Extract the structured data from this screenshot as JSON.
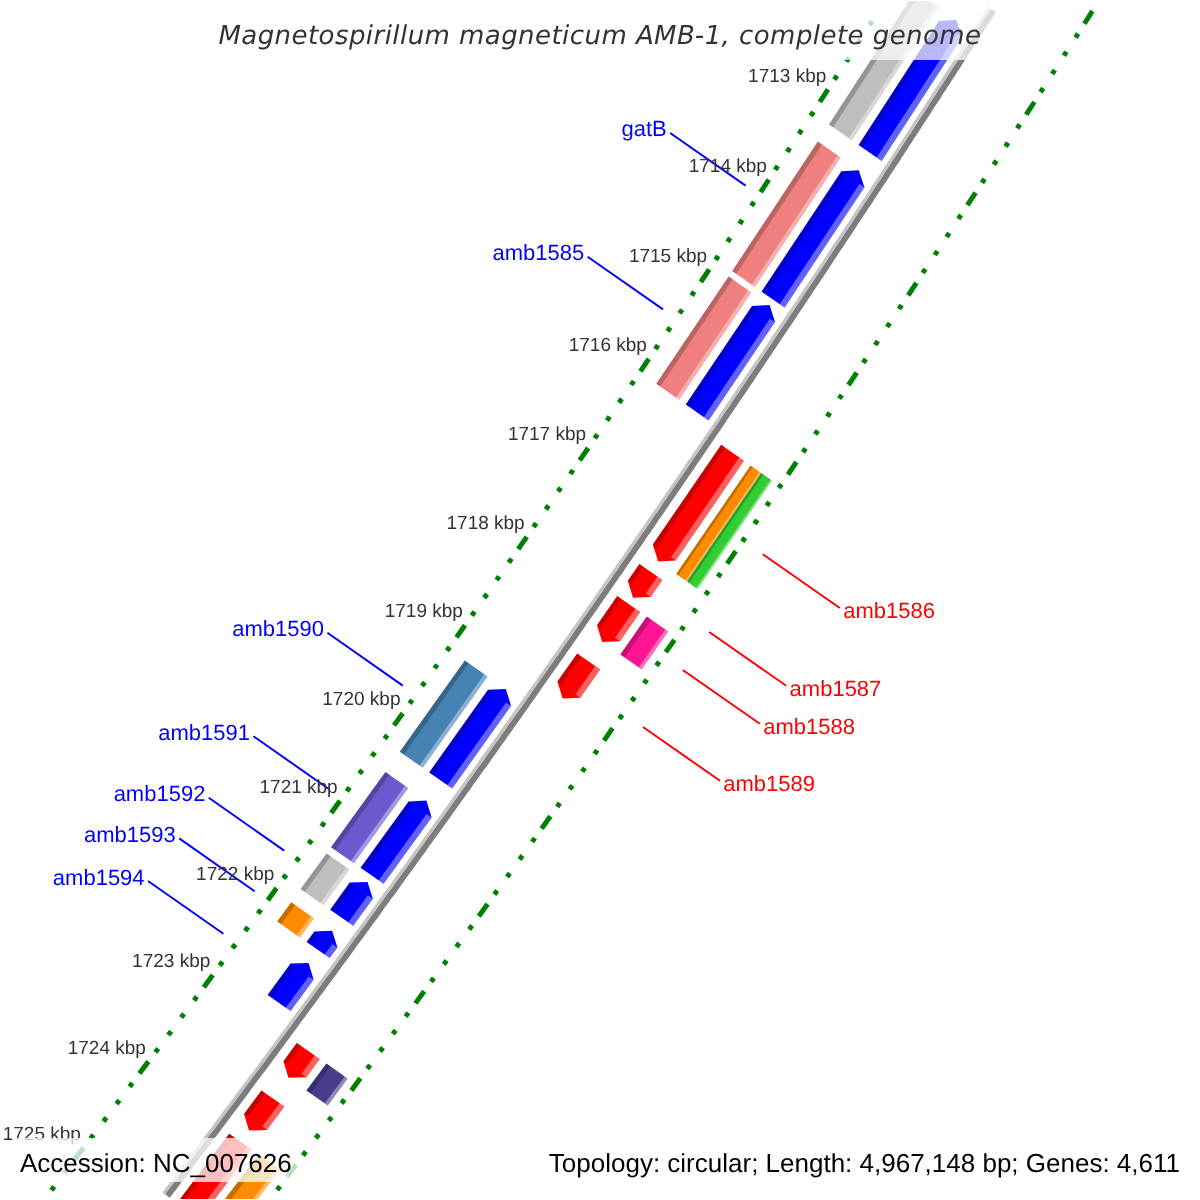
{
  "title": "Magnetospirillum magneticum AMB-1, complete genome",
  "map": {
    "ticks": [
      "1713 kbp",
      "1714 kbp",
      "1715 kbp",
      "1716 kbp",
      "1717 kbp",
      "1718 kbp",
      "1719 kbp",
      "1720 kbp",
      "1721 kbp",
      "1722 kbp",
      "1723 kbp",
      "1724 kbp",
      "1725 kbp"
    ],
    "features": [
      {
        "kind": "forward",
        "categories": [
          {
            "color": "#bebebe"
          }
        ]
      },
      {
        "kind": "forward",
        "label": "gatB",
        "categories": [
          {
            "color": "#f08080"
          }
        ]
      },
      {
        "kind": "forward",
        "label": "amb1585",
        "categories": [
          {
            "color": "#f08080"
          }
        ]
      },
      {
        "kind": "reverse",
        "label": "amb1586",
        "categories": [
          {
            "color": "#ff8c00"
          },
          {
            "color": "#32cd32"
          }
        ]
      },
      {
        "kind": "reverse",
        "label": "amb1587"
      },
      {
        "kind": "reverse",
        "label": "amb1588",
        "categories": [
          {
            "color": "#ff1493"
          }
        ]
      },
      {
        "kind": "reverse",
        "label": "amb1589"
      },
      {
        "kind": "forward",
        "label": "amb1590",
        "categories": [
          {
            "color": "#4682b4"
          }
        ]
      },
      {
        "kind": "forward",
        "label": "amb1591",
        "categories": [
          {
            "color": "#6a5acd"
          }
        ]
      },
      {
        "kind": "forward",
        "label": "amb1592",
        "categories": [
          {
            "color": "#bebebe"
          }
        ]
      },
      {
        "kind": "forward",
        "label": "amb1593",
        "categories": [
          {
            "color": "#ff8c00"
          }
        ]
      },
      {
        "kind": "forward",
        "label": "amb1594"
      },
      {
        "kind": "reverse",
        "categories": [
          {
            "color": "#483d8b"
          }
        ]
      },
      {
        "kind": "reverse"
      },
      {
        "kind": "reverse",
        "categories": [
          {
            "color": "#ff8c00"
          }
        ]
      }
    ]
  },
  "footer": {
    "accession": "Accession: NC_007626",
    "summary": "Topology: circular; Length: 4,967,148 bp; Genes: 4,611"
  }
}
